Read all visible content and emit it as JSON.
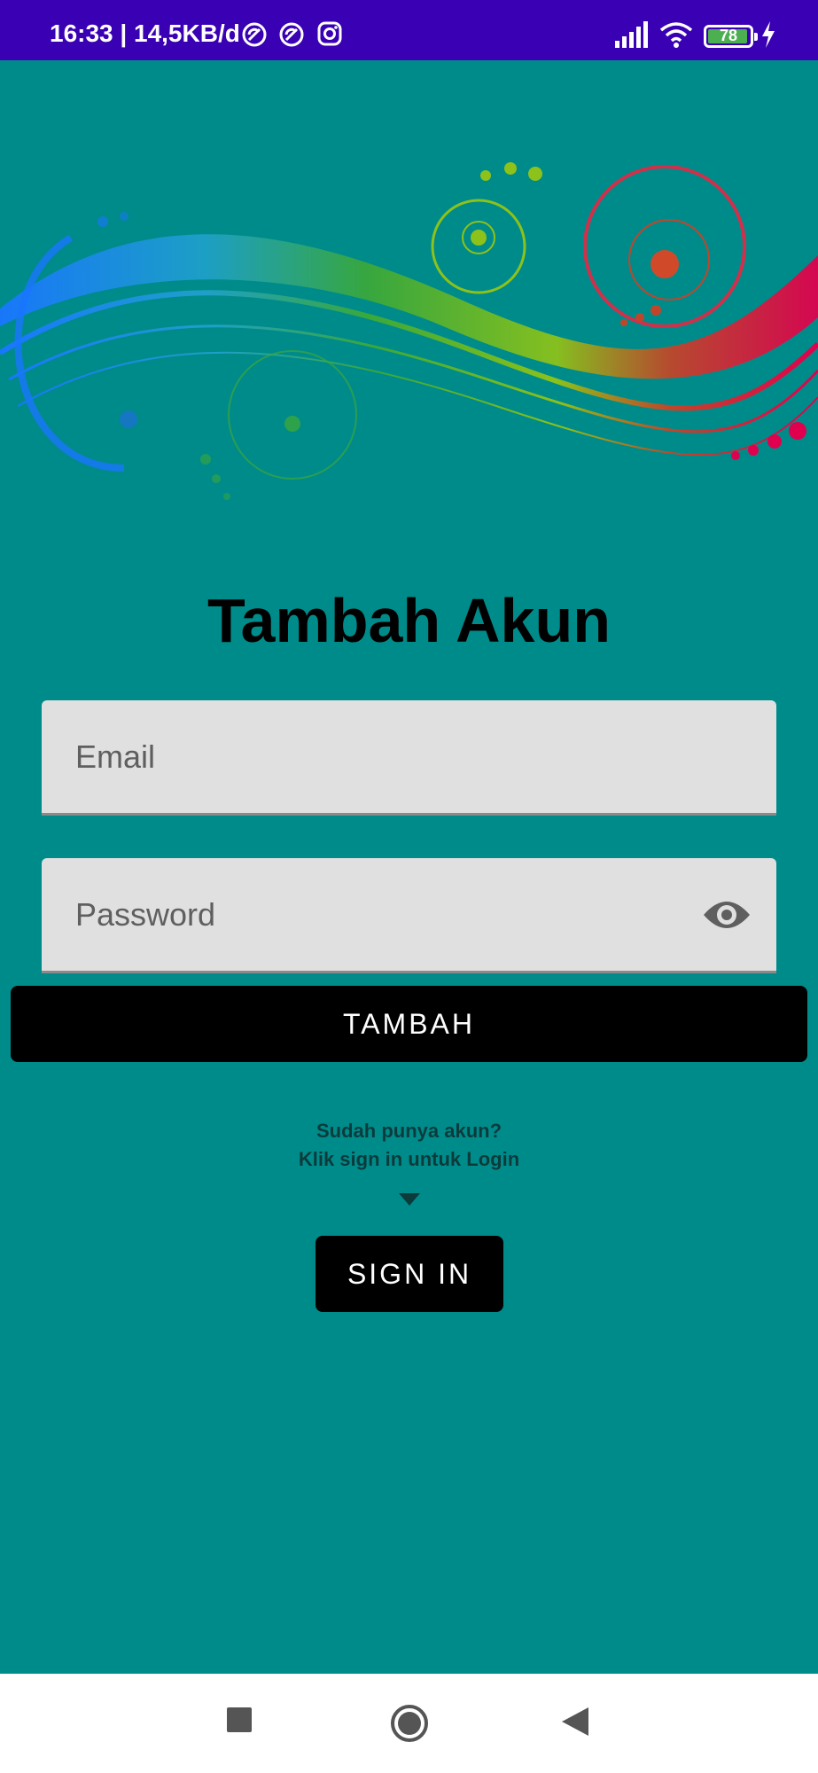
{
  "status_bar": {
    "time_speed": "16:33 | 14,5KB/d",
    "battery_level": "78",
    "icons": [
      "sync-icon",
      "sync-icon",
      "instagram-icon",
      "signal-icon",
      "wifi-icon",
      "battery-icon",
      "charging-icon"
    ],
    "background_color": "#3a00b3"
  },
  "app": {
    "background_color": "#008b8b",
    "title": "Tambah Akun",
    "email_placeholder": "Email",
    "password_placeholder": "Password",
    "tambah_label": "TAMBAH",
    "hint_line1": "Sudah punya akun?",
    "hint_line2": "Klik sign in untuk Login",
    "signin_label": "SIGN IN"
  },
  "nav_bar": {
    "buttons": [
      "recents-icon",
      "home-icon",
      "back-icon"
    ]
  }
}
